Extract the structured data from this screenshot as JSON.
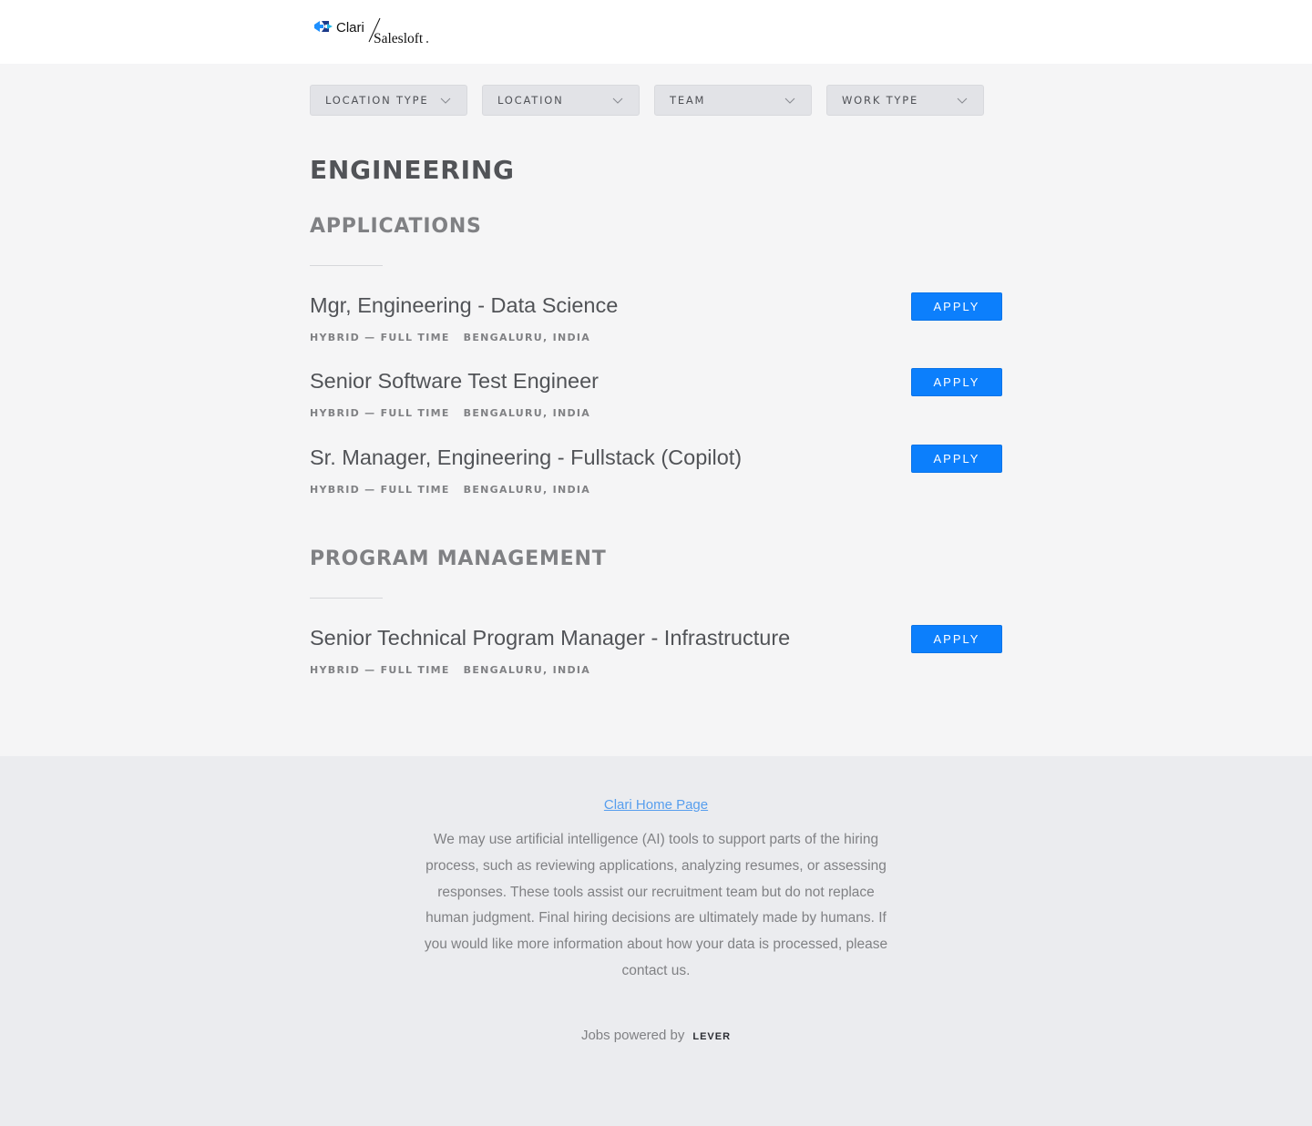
{
  "header": {
    "logo_primary": "Clari",
    "logo_secondary": "Salesloft",
    "logo_colors": [
      "#1e90ff",
      "#1b3a8a",
      "#111111"
    ]
  },
  "filters": [
    {
      "label": "LOCATION TYPE"
    },
    {
      "label": "LOCATION"
    },
    {
      "label": "TEAM"
    },
    {
      "label": "WORK TYPE"
    }
  ],
  "department": "ENGINEERING",
  "teams": [
    {
      "name": "APPLICATIONS",
      "postings": [
        {
          "title": "Mgr, Engineering - Data Science",
          "commitment": "HYBRID — FULL TIME",
          "location": "BENGALURU, INDIA",
          "apply_label": "APPLY"
        },
        {
          "title": "Senior Software Test Engineer",
          "commitment": "HYBRID — FULL TIME",
          "location": "BENGALURU, INDIA",
          "apply_label": "APPLY"
        },
        {
          "title": "Sr. Manager, Engineering - Fullstack (Copilot)",
          "commitment": "HYBRID — FULL TIME",
          "location": "BENGALURU, INDIA",
          "apply_label": "APPLY"
        }
      ]
    },
    {
      "name": "PROGRAM MANAGEMENT",
      "postings": [
        {
          "title": "Senior Technical Program Manager - Infrastructure",
          "commitment": "HYBRID — FULL TIME",
          "location": "BENGALURU, INDIA",
          "apply_label": "APPLY"
        }
      ]
    }
  ],
  "footer": {
    "home_link": "Clari Home Page",
    "ai_notice": "We may use artificial intelligence (AI) tools to support parts of the hiring process, such as reviewing applications, analyzing resumes, or assessing responses. These tools assist our recruitment team but do not replace human judgment. Final hiring decisions are ultimately made by humans. If you would like more information about how your data is processed, please contact us.",
    "powered_by": "Jobs powered by",
    "lever_logo": "LEVER"
  },
  "colors": {
    "accent": "#0c7ffc",
    "link": "#579eee",
    "page_bg": "#f5f5f6",
    "footer_bg": "#ebecef"
  },
  "icons": {
    "filter_dropdown": "chevron-down-icon",
    "brand_mark": "clari-logo-icon"
  }
}
